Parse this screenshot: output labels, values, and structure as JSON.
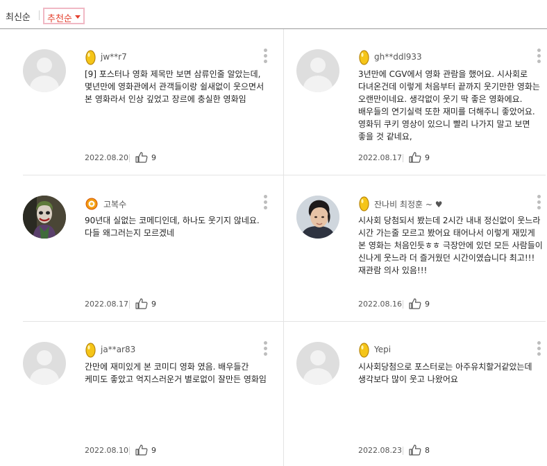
{
  "sort": {
    "latest": "최신순",
    "recommended": "추천순"
  },
  "reviews": [
    {
      "nickname": "jw**r7",
      "badge": "gold",
      "avatar": "default",
      "text": "[9] 포스터나 영화 제목만 보면 삼류인줄 알았는데, 몇년만에 영화관에서 관객들이랑 쉴새없이 웃으면서 본 영화라서 인상 깊었고 장르에 충실한 영화임",
      "date": "2022.08.20",
      "likes": "9"
    },
    {
      "nickname": "gh**ddl933",
      "badge": "gold",
      "avatar": "default",
      "text": "3년만에 CGV에서 영화 관람을 했어요. 시사회로 다녀온건데 이렇게 처음부터 끝까지 웃기만한 영화는 오랜만이네요. 생각없이 웃기 딱 좋은 영화에요. 배우들의 연기실력 또한 재미를 더해주니 좋았어요. 영화뒤 쿠키 영상이 있으니 빨리 나가지 말고 보면 좋을 것 같네요,",
      "date": "2022.08.17",
      "likes": "9"
    },
    {
      "nickname": "고복수",
      "badge": "egg",
      "avatar": "joker-photo",
      "text": "90년대 실없는 코메디인데, 하나도 웃기지 않네요. 다들 왜그러는지 모르겠네",
      "date": "2022.08.17",
      "likes": "9"
    },
    {
      "nickname": "잔나비 최정훈 ~ ♥",
      "badge": "gold",
      "avatar": "man-photo",
      "text": "시사회 당첨되서 봤는데 2시간 내내 정신없이 웃느라 시간 가는줄 모르고 봤어요 태어나서 이렇게 재밌게 본 영화는 처음인듯ㅎㅎ 극장안에 있던 모든 사람들이 신나게 웃느라 더 즐거웠던 시간이였습니다 최고!!! 재관람 의사 있음!!!",
      "date": "2022.08.16",
      "likes": "9"
    },
    {
      "nickname": "ja**ar83",
      "badge": "gold",
      "avatar": "default",
      "text": "간만에 재미있게 본 코미디 영화 였음. 배우들간 케미도 좋았고 억지스러운거 별로없이 잘만든 영화임",
      "date": "2022.08.10",
      "likes": "9"
    },
    {
      "nickname": "Yepi",
      "badge": "gold",
      "avatar": "default",
      "text": "시사회당첨으로 포스터로는 아주유치할거같았는데 생각보다 많이 웃고 나왔어요",
      "date": "2022.08.23",
      "likes": "8"
    }
  ],
  "colors": {
    "accent": "#e4402e",
    "gold": "#f5c518",
    "divider": "#e3e3e3"
  },
  "icons": {
    "badge": "gold-egg-icon",
    "like": "thumbs-up-icon",
    "menu": "more-vertical-icon"
  }
}
